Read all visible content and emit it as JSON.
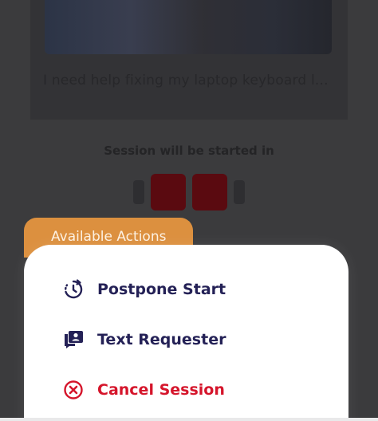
{
  "background": {
    "video_title": "I need help fixing my laptop keyboard l...",
    "session_text": "Session will be started in"
  },
  "sheet": {
    "tab_label": "Available Actions",
    "actions": [
      {
        "label": "Postpone Start",
        "icon": "clock-postpone-icon"
      },
      {
        "label": "Text Requester",
        "icon": "chat-user-icon"
      },
      {
        "label": "Cancel Session",
        "icon": "cancel-circle-icon"
      }
    ]
  },
  "colors": {
    "accent": "#dc903f",
    "primary_text": "#242156",
    "danger": "#d5152b",
    "overlay": "#3b3b3d"
  }
}
